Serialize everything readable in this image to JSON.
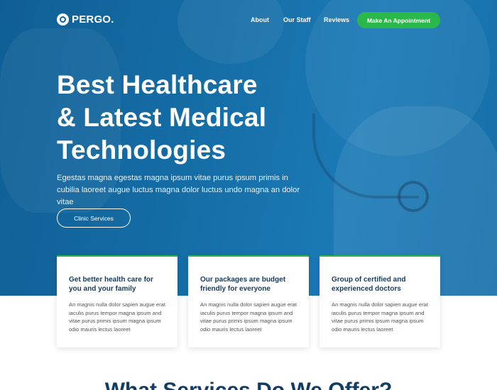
{
  "brand": {
    "name": "PERGO."
  },
  "nav": {
    "items": [
      "About",
      "Our Staff",
      "Reviews"
    ],
    "cta": "Make An Appointment"
  },
  "hero": {
    "title_lines": [
      "Best Healthcare",
      "& Latest Medical",
      "Technologies"
    ],
    "subtitle": "Egestas magna egestas magna ipsum vitae purus ipsum primis in cubilia laoreet augue luctus magna dolor luctus undo magna an dolor vitae",
    "button": "Clinic Services"
  },
  "cards": [
    {
      "title": "Get better health care for you and your family",
      "text": "An magnis nulla dolor sapien augue erat iaculis purus tempor magna ipsum and vitae purus primis ipsum magna ipsum odio mauris lectus laoreet"
    },
    {
      "title": "Our packages are budget friendly for everyone",
      "text": "An magnis nulla dolor sapien augue erat iaculis purus tempor magna ipsum and vitae purus primis ipsum magna ipsum odio mauris lectus laoreet"
    },
    {
      "title": "Group of certified and experienced doctors",
      "text": "An magnis nulla dolor sapien augue erat iaculis purus tempor magna ipsum and vitae purus primis ipsum magna ipsum odio mauris lectus laoreet"
    }
  ],
  "services": {
    "title": "What Services Do We Offer?"
  },
  "colors": {
    "hero_blue": "#166fa8",
    "accent_green": "#2bb84a",
    "heading_navy": "#123c63"
  }
}
